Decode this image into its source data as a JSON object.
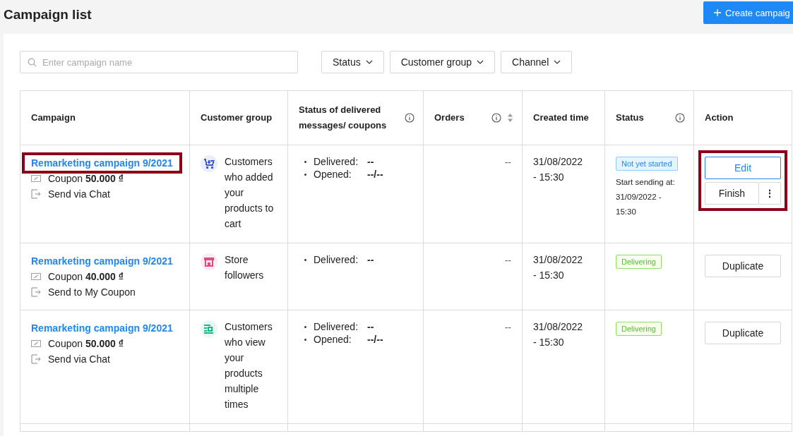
{
  "page": {
    "title": "Campaign list",
    "create_button": "Create campaig"
  },
  "search": {
    "placeholder": "Enter campaign name"
  },
  "filters": [
    "Status",
    "Customer group",
    "Channel"
  ],
  "table": {
    "columns": [
      {
        "label": "Campaign",
        "info": false,
        "sortable": false
      },
      {
        "label": "Customer group",
        "info": false,
        "sortable": false
      },
      {
        "label": "Status of delivered messages/ coupons",
        "info": true,
        "sortable": false
      },
      {
        "label": "Orders",
        "info": true,
        "sortable": true
      },
      {
        "label": "Created time",
        "info": false,
        "sortable": false
      },
      {
        "label": "Status",
        "info": true,
        "sortable": false
      },
      {
        "label": "Action",
        "info": false,
        "sortable": false
      }
    ],
    "rows": [
      {
        "name": "Remarketing campaign 9/2021",
        "highlighted": true,
        "coupon_label": "Coupon",
        "coupon_amount": "50.000 ₫",
        "channel": "Send via Chat",
        "group": {
          "kind": "cart",
          "color": "#3b5bdb",
          "label": "Customers who added your products to cart"
        },
        "stats": [
          {
            "label": "Delivered:",
            "value": "--"
          },
          {
            "label": "Opened:",
            "value": "--/--"
          }
        ],
        "orders": "--",
        "created": "31/08/2022 - 15:30",
        "status": {
          "kind": "pending",
          "label": "Not yet started",
          "note": "Start sending at: 31/09/2022 - 15:30"
        },
        "actions_highlighted": true,
        "actions": [
          {
            "kind": "primary",
            "label": "Edit"
          },
          {
            "kind": "split",
            "label": "Finish",
            "more": "⋮"
          }
        ]
      },
      {
        "name": "Remarketing campaign 9/2021",
        "highlighted": false,
        "coupon_label": "Coupon",
        "coupon_amount": "40.000 ₫",
        "channel": "Send to My Coupon",
        "group": {
          "kind": "store",
          "color": "#e64980",
          "label": "Store followers"
        },
        "stats": [
          {
            "label": "Delivered:",
            "value": "--"
          }
        ],
        "orders": "--",
        "created": "31/08/2022 - 15:30",
        "status": {
          "kind": "delivering",
          "label": "Delivering"
        },
        "actions_highlighted": false,
        "actions": [
          {
            "kind": "default",
            "label": "Duplicate"
          }
        ]
      },
      {
        "name": "Remarketing campaign 9/2021",
        "highlighted": false,
        "coupon_label": "Coupon",
        "coupon_amount": "50.000 ₫",
        "channel": "Send via Chat",
        "group": {
          "kind": "view",
          "color": "#12b886",
          "label": "Customers who view your products multiple times"
        },
        "stats": [
          {
            "label": "Delivered:",
            "value": "--"
          },
          {
            "label": "Opened:",
            "value": "--/--"
          }
        ],
        "orders": "--",
        "created": "31/08/2022 - 15:30",
        "status": {
          "kind": "delivering",
          "label": "Delivering"
        },
        "actions_highlighted": false,
        "actions": [
          {
            "kind": "default",
            "label": "Duplicate"
          }
        ]
      }
    ]
  }
}
